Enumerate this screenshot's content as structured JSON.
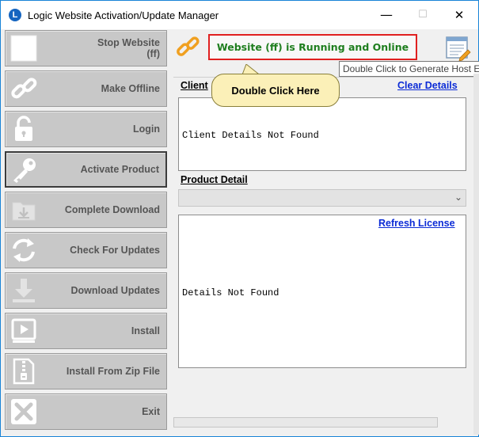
{
  "window": {
    "title": "Logic Website Activation/Update Manager",
    "app_icon_letter": "L",
    "controls": {
      "minimize": "—",
      "maximize": "☐",
      "close": "✕"
    }
  },
  "sidebar": {
    "items": [
      {
        "label_line1": "Stop Website",
        "label_line2": "(ff)",
        "icon": "stop-square-icon"
      },
      {
        "label_line1": "Make Offline",
        "label_line2": "",
        "icon": "link-icon"
      },
      {
        "label_line1": "Login",
        "label_line2": "",
        "icon": "lock-open-icon"
      },
      {
        "label_line1": "Activate Product",
        "label_line2": "",
        "icon": "key-icon"
      },
      {
        "label_line1": "Complete Download",
        "label_line2": "",
        "icon": "folder-download-icon"
      },
      {
        "label_line1": "Check For Updates",
        "label_line2": "",
        "icon": "refresh-arrows-icon"
      },
      {
        "label_line1": "Download Updates",
        "label_line2": "",
        "icon": "download-arrow-icon"
      },
      {
        "label_line1": "Install",
        "label_line2": "",
        "icon": "play-install-icon"
      },
      {
        "label_line1": "Install From Zip File",
        "label_line2": "",
        "icon": "zip-file-icon"
      },
      {
        "label_line1": "Exit",
        "label_line2": "",
        "icon": "close-x-icon"
      }
    ]
  },
  "header": {
    "status_text": "Website (ff) is Running and Online",
    "tooltip": "Double Click to Generate Host Entry"
  },
  "client": {
    "label": "Client",
    "clear_link": "Clear Details",
    "details_text": "Client Details Not Found",
    "callout": "Double Click Here"
  },
  "product": {
    "label": "Product Detail",
    "select_value": "",
    "refresh_link": "Refresh License",
    "details_text": "Details Not Found"
  },
  "colors": {
    "status_green": "#1e7e1e",
    "status_border": "#e02020",
    "link_blue": "#0b2bd6",
    "link_icon_orange": "#f0a020"
  }
}
